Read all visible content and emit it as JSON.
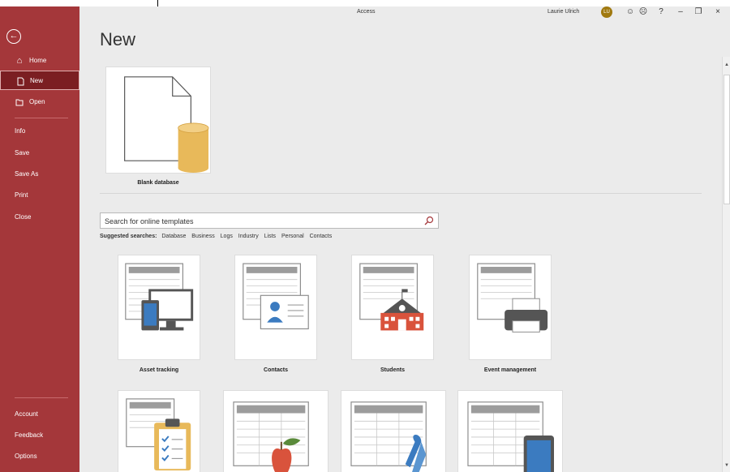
{
  "window": {
    "app_title": "Access",
    "user_name": "Laurie Ulrich",
    "user_initials": "LU",
    "smile_glyph": "☺",
    "frown_glyph": "☹",
    "help_glyph": "?",
    "minimize_glyph": "–",
    "restore_glyph": "❐",
    "close_glyph": "×"
  },
  "sidebar": {
    "back_glyph": "←",
    "items": [
      {
        "label": "Home",
        "icon": "home-icon"
      },
      {
        "label": "New",
        "icon": "new-document-icon",
        "active": true
      },
      {
        "label": "Open",
        "icon": "folder-open-icon"
      },
      {
        "label": "Info"
      },
      {
        "label": "Save"
      },
      {
        "label": "Save As"
      },
      {
        "label": "Print"
      },
      {
        "label": "Close"
      }
    ],
    "bottom_items": [
      {
        "label": "Account"
      },
      {
        "label": "Feedback"
      },
      {
        "label": "Options"
      }
    ]
  },
  "main": {
    "page_title": "New",
    "blank_database_label": "Blank database",
    "search": {
      "placeholder": "Search for online templates",
      "value": ""
    },
    "suggested": {
      "prefix": "Suggested searches:",
      "terms": [
        "Database",
        "Business",
        "Logs",
        "Industry",
        "Lists",
        "Personal",
        "Contacts"
      ]
    },
    "templates_row1": [
      {
        "label": "Asset tracking",
        "icon": "laptop-phone-icon"
      },
      {
        "label": "Contacts",
        "icon": "contact-card-icon"
      },
      {
        "label": "Students",
        "icon": "school-icon"
      },
      {
        "label": "Event management",
        "icon": "printer-icon"
      }
    ],
    "templates_row2": [
      {
        "icon": "clipboard-checklist-icon"
      },
      {
        "icon": "apple-icon"
      },
      {
        "icon": "ribbon-icon"
      },
      {
        "icon": "tablet-icon"
      }
    ]
  },
  "colors": {
    "sidebar": "#a4373a",
    "sidebar_active": "#7b1e22",
    "background": "#ebebeb",
    "database_cylinder": "#e8b95a"
  }
}
